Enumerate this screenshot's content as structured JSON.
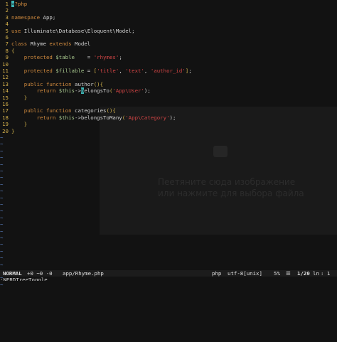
{
  "editor": {
    "lines": [
      {
        "num": "1",
        "parts": [
          {
            "t": "<",
            "c": "cursor"
          },
          {
            "t": "?php",
            "c": "kw"
          }
        ]
      },
      {
        "num": "2",
        "parts": []
      },
      {
        "num": "3",
        "parts": [
          {
            "t": "namespace",
            "c": "ns"
          },
          {
            "t": " App;",
            "c": "plain"
          }
        ]
      },
      {
        "num": "4",
        "parts": []
      },
      {
        "num": "5",
        "parts": [
          {
            "t": "use",
            "c": "ns"
          },
          {
            "t": " Illuminate\\Database\\Eloquent\\Model;",
            "c": "plain"
          }
        ]
      },
      {
        "num": "6",
        "parts": []
      },
      {
        "num": "7",
        "parts": [
          {
            "t": "class",
            "c": "kw"
          },
          {
            "t": " Rhyme ",
            "c": "plain"
          },
          {
            "t": "extends",
            "c": "kw"
          },
          {
            "t": " Model",
            "c": "plain"
          }
        ]
      },
      {
        "num": "8",
        "parts": [
          {
            "t": "{",
            "c": "punct"
          }
        ]
      },
      {
        "num": "9",
        "parts": [
          {
            "t": "    protected ",
            "c": "kw"
          },
          {
            "t": "$table",
            "c": "var"
          },
          {
            "t": "    = ",
            "c": "plain"
          },
          {
            "t": "'rhymes'",
            "c": "str"
          },
          {
            "t": ";",
            "c": "plain"
          }
        ]
      },
      {
        "num": "10",
        "parts": []
      },
      {
        "num": "11",
        "parts": [
          {
            "t": "    protected ",
            "c": "kw"
          },
          {
            "t": "$fillable",
            "c": "var"
          },
          {
            "t": " = ",
            "c": "plain"
          },
          {
            "t": "[",
            "c": "punct"
          },
          {
            "t": "'title'",
            "c": "str"
          },
          {
            "t": ", ",
            "c": "plain"
          },
          {
            "t": "'text'",
            "c": "str"
          },
          {
            "t": ", ",
            "c": "plain"
          },
          {
            "t": "'author_id'",
            "c": "str"
          },
          {
            "t": "]",
            "c": "punct"
          },
          {
            "t": ";",
            "c": "plain"
          }
        ]
      },
      {
        "num": "12",
        "parts": []
      },
      {
        "num": "13",
        "parts": [
          {
            "t": "    public function ",
            "c": "kw"
          },
          {
            "t": "author",
            "c": "plain"
          },
          {
            "t": "(){",
            "c": "punct"
          }
        ]
      },
      {
        "num": "14",
        "parts": [
          {
            "t": "        return ",
            "c": "kw"
          },
          {
            "t": "$this",
            "c": "var"
          },
          {
            "t": "->",
            "c": "plain"
          },
          {
            "t": "b",
            "c": "cursor"
          },
          {
            "t": "elongsTo",
            "c": "plain"
          },
          {
            "t": "(",
            "c": "punct"
          },
          {
            "t": "'App\\User'",
            "c": "str"
          },
          {
            "t": ");",
            "c": "plain"
          }
        ]
      },
      {
        "num": "15",
        "parts": [
          {
            "t": "    }",
            "c": "punct"
          }
        ]
      },
      {
        "num": "16",
        "parts": []
      },
      {
        "num": "17",
        "parts": [
          {
            "t": "    public function ",
            "c": "kw"
          },
          {
            "t": "categories",
            "c": "plain"
          },
          {
            "t": "(){",
            "c": "punct"
          }
        ]
      },
      {
        "num": "18",
        "parts": [
          {
            "t": "        return ",
            "c": "kw"
          },
          {
            "t": "$this",
            "c": "var"
          },
          {
            "t": "->",
            "c": "plain"
          },
          {
            "t": "belongsToMany",
            "c": "plain"
          },
          {
            "t": "(",
            "c": "punct"
          },
          {
            "t": "'App\\Category'",
            "c": "str"
          },
          {
            "t": ");",
            "c": "plain"
          }
        ]
      },
      {
        "num": "19",
        "parts": [
          {
            "t": "    }",
            "c": "punct"
          }
        ]
      },
      {
        "num": "20",
        "parts": [
          {
            "t": "}",
            "c": "punct"
          }
        ]
      }
    ],
    "tilde_count": 23,
    "tilde_char": "~"
  },
  "statusbar": {
    "mode": "NORMAL",
    "git": "+0 ~0 -0",
    "file": "app/Rhyme.php",
    "filetype": "php",
    "encoding": "utf-8[unix]",
    "percent": "5%",
    "menu_icon": "☰",
    "position": "1/20",
    "ln_icon": "ln",
    "column": ": 1"
  },
  "cmdline": {
    "text": ":NERDTreeToggle"
  },
  "ghost_overlay": {
    "title_line1": "Пеетяните сюда изображение",
    "title_line2": "или нажмите для выбора файла"
  }
}
